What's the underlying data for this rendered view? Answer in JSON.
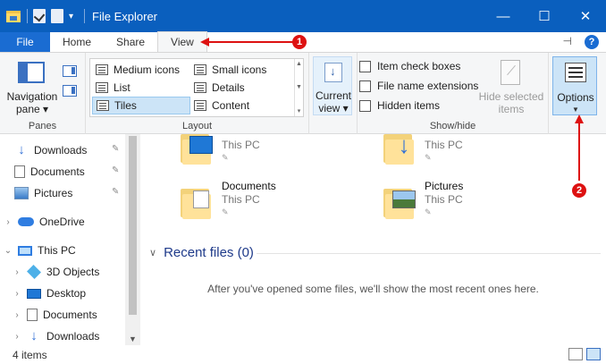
{
  "titlebar": {
    "title": "File Explorer",
    "controls": {
      "minimize": "—",
      "maximize": "☐",
      "close": "✕"
    }
  },
  "ribbon_tabs": [
    "File",
    "Home",
    "Share",
    "View"
  ],
  "ribbon_tabs_active": "View",
  "ribbon_help": "?",
  "panes_group": {
    "label": "Panes",
    "navigation_pane_line1": "Navigation",
    "navigation_pane_line2": "pane ▾"
  },
  "layout_group": {
    "label": "Layout",
    "items": [
      "Medium icons",
      "Small icons",
      "List",
      "Details",
      "Tiles",
      "Content"
    ],
    "selected": "Tiles"
  },
  "current_view": {
    "line1": "Current",
    "line2": "view ▾"
  },
  "showhide_group": {
    "label": "Show/hide",
    "checkboxes": [
      "Item check boxes",
      "File name extensions",
      "Hidden items"
    ],
    "hide_selected_line1": "Hide selected",
    "hide_selected_line2": "items"
  },
  "options": {
    "label": "Options",
    "caret": "▼"
  },
  "nav_pane": {
    "quick_access": [
      {
        "name": "Downloads",
        "icon": "download-icon",
        "pinned": true
      },
      {
        "name": "Documents",
        "icon": "documents-icon",
        "pinned": true
      },
      {
        "name": "Pictures",
        "icon": "pictures-icon",
        "pinned": true
      }
    ],
    "onedrive": "OneDrive",
    "thispc": "This PC",
    "thispc_items": [
      {
        "name": "3D Objects",
        "icon": "3d-objects-icon"
      },
      {
        "name": "Desktop",
        "icon": "desktop-icon"
      },
      {
        "name": "Documents",
        "icon": "documents-icon"
      },
      {
        "name": "Downloads",
        "icon": "download-icon"
      }
    ]
  },
  "content": {
    "tiles": [
      {
        "name": "",
        "sub": "This PC",
        "icon": "desktop-folder-icon"
      },
      {
        "name": "",
        "sub": "This PC",
        "icon": "downloads-folder-icon"
      },
      {
        "name": "Documents",
        "sub": "This PC",
        "icon": "documents-folder-icon"
      },
      {
        "name": "Pictures",
        "sub": "This PC",
        "icon": "pictures-folder-icon"
      }
    ],
    "recent_header": "Recent files (0)",
    "recent_empty": "After you've opened some files, we'll show the most recent ones here."
  },
  "status": {
    "items_count": "4 items"
  },
  "annotations": {
    "badge1": "1",
    "badge2": "2",
    "color": "#dd1111"
  }
}
